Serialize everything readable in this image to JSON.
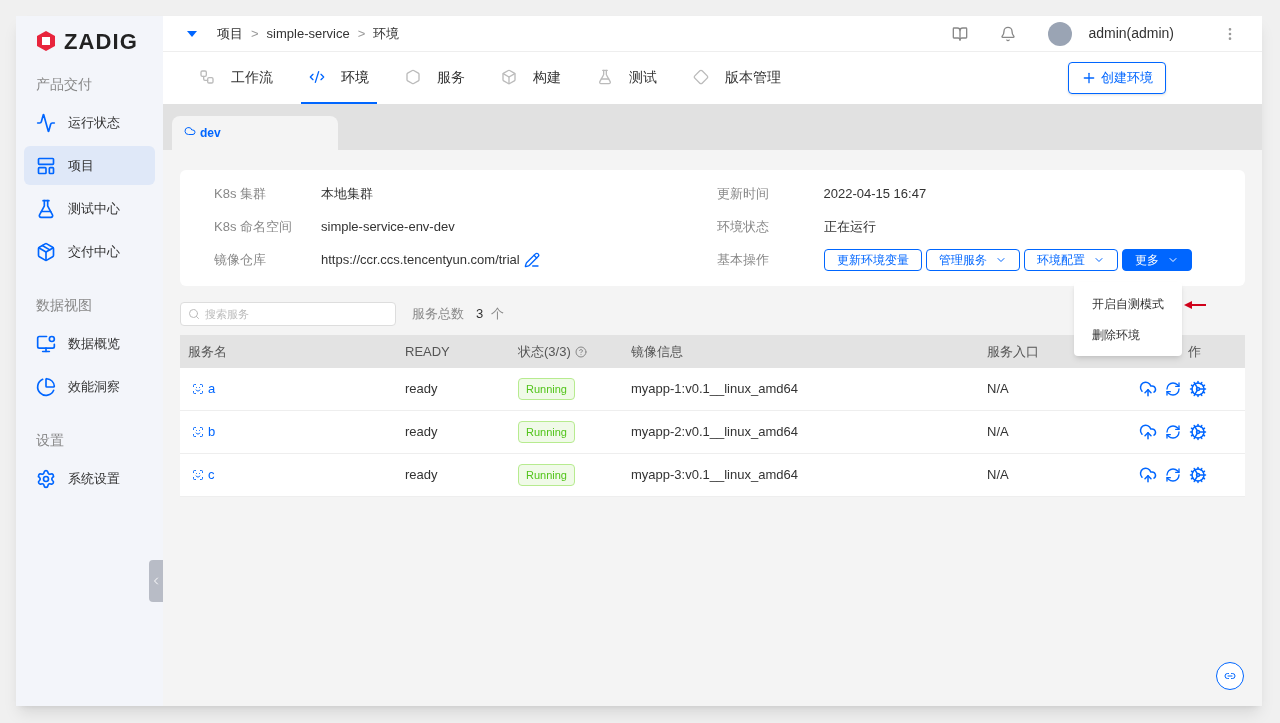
{
  "logo": {
    "text": "ZADIG"
  },
  "sidebar": {
    "sections": [
      {
        "title": "产品交付",
        "items": [
          {
            "label": "运行状态",
            "selected": false
          },
          {
            "label": "项目",
            "selected": true
          },
          {
            "label": "测试中心",
            "selected": false
          },
          {
            "label": "交付中心",
            "selected": false
          }
        ]
      },
      {
        "title": "数据视图",
        "items": [
          {
            "label": "数据概览",
            "selected": false
          },
          {
            "label": "效能洞察",
            "selected": false
          }
        ]
      },
      {
        "title": "设置",
        "items": [
          {
            "label": "系统设置",
            "selected": false
          }
        ]
      }
    ]
  },
  "breadcrumb": {
    "items": [
      "项目",
      "simple-service",
      "环境"
    ],
    "separator": ">"
  },
  "user": {
    "name": "admin(admin)"
  },
  "tabs": [
    {
      "label": "工作流",
      "selected": false
    },
    {
      "label": "环境",
      "selected": true
    },
    {
      "label": "服务",
      "selected": false
    },
    {
      "label": "构建",
      "selected": false
    },
    {
      "label": "测试",
      "selected": false
    },
    {
      "label": "版本管理",
      "selected": false
    }
  ],
  "create_button": "创建环境",
  "env_tabs": [
    {
      "label": "dev",
      "selected": true
    }
  ],
  "info": {
    "left": [
      {
        "label": "K8s 集群",
        "value": "本地集群"
      },
      {
        "label": "K8s 命名空间",
        "value": "simple-service-env-dev"
      },
      {
        "label": "镜像仓库",
        "value": "https://ccr.ccs.tencentyun.com/trial",
        "editable": true
      }
    ],
    "right": [
      {
        "label": "更新时间",
        "value": "2022-04-15 16:47"
      },
      {
        "label": "环境状态",
        "value": "正在运行"
      }
    ],
    "actions_label": "基本操作",
    "actions": [
      {
        "label": "更新环境变量",
        "dropdown": false,
        "primary": false
      },
      {
        "label": "管理服务",
        "dropdown": true,
        "primary": false
      },
      {
        "label": "环境配置",
        "dropdown": true,
        "primary": false
      },
      {
        "label": "更多",
        "dropdown": true,
        "primary": true
      }
    ]
  },
  "menu": {
    "items": [
      "开启自测模式",
      "删除环境"
    ]
  },
  "search": {
    "placeholder": "搜索服务"
  },
  "count": {
    "label": "服务总数",
    "value": "3",
    "unit": "个"
  },
  "table": {
    "columns": [
      "服务名",
      "READY",
      "状态(3/3)",
      "镜像信息",
      "服务入口",
      "作"
    ],
    "rows": [
      {
        "name": "a",
        "ready": "ready",
        "status": "Running",
        "image": "myapp-1:v0.1__linux_amd64",
        "entry": "N/A"
      },
      {
        "name": "b",
        "ready": "ready",
        "status": "Running",
        "image": "myapp-2:v0.1__linux_amd64",
        "entry": "N/A"
      },
      {
        "name": "c",
        "ready": "ready",
        "status": "Running",
        "image": "myapp-3:v0.1__linux_amd64",
        "entry": "N/A"
      }
    ]
  }
}
